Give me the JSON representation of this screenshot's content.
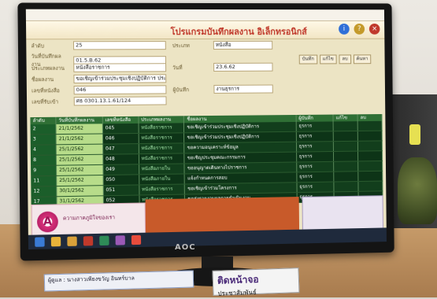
{
  "app": {
    "title": "โปรแกรมบันทึกผลงาน อิเล็กทรอนิกส์",
    "form": {
      "field1_label": "ลำดับ",
      "field1_value": "25",
      "field2_label": "วันที่บันทึกผลงาน",
      "field2_value": "01.5.B.62",
      "field3_label": "ประเภทผลงาน",
      "field3_value": "หนังสือราชการ",
      "field4_label": "ชื่อผลงาน",
      "field4_value": "ขอเชิญเข้าร่วมประชุมเชิงปฏิบัติการ ประจำปีการศึกษา",
      "field5_label": "เลขที่หนังสือ",
      "field5_value": "046",
      "field6_label": "เลขที่รับเข้า",
      "field6_value": "ศธ 0301.13.1.61/124",
      "right_label1": "ประเภท",
      "right_value1": "หนังสือ",
      "right_label2": "วันที่",
      "right_value2": "23.6.62",
      "right_label3": "ผู้บันทึก",
      "right_value3": "งานธุรการ",
      "button_labels": [
        "บันทึก",
        "แก้ไข",
        "ลบ",
        "ค้นหา"
      ]
    },
    "grid": {
      "headers": [
        "ลำดับ",
        "วันที่บันทึกผลงาน",
        "เลขที่หนังสือ",
        "ประเภทผลงาน",
        "ชื่อผลงาน",
        "ผู้บันทึก",
        "แก้ไข",
        "ลบ"
      ],
      "rows": [
        [
          "2",
          "21/1/2562",
          "045",
          "หนังสือราชการ",
          "ขอเชิญเข้าร่วมประชุมเชิงปฏิบัติการ",
          "ธุรการ",
          "",
          ""
        ],
        [
          "3",
          "21/1/2562",
          "046",
          "หนังสือราชการ",
          "ขอเชิญเข้าร่วมประชุมเชิงปฏิบัติการ",
          "ธุรการ",
          "",
          ""
        ],
        [
          "4",
          "25/1/2562",
          "047",
          "หนังสือราชการ",
          "ขอความอนุเคราะห์ข้อมูล",
          "ธุรการ",
          "",
          ""
        ],
        [
          "8",
          "25/1/2562",
          "048",
          "หนังสือราชการ",
          "ขอเชิญประชุมคณะกรรมการ",
          "ธุรการ",
          "",
          ""
        ],
        [
          "9",
          "25/1/2562",
          "049",
          "หนังสือภายใน",
          "ขออนุญาตเดินทางไปราชการ",
          "ธุรการ",
          "",
          ""
        ],
        [
          "11",
          "25/1/2562",
          "050",
          "หนังสือภายใน",
          "แจ้งกำหนดการสอบ",
          "ธุรการ",
          "",
          ""
        ],
        [
          "12",
          "30/1/2562",
          "051",
          "หนังสือราชการ",
          "ขอเชิญเข้าร่วมโครงการ",
          "ธุรการ",
          "",
          ""
        ],
        [
          "17",
          "31/1/2562",
          "052",
          "หนังสือราชการ",
          "ขอส่งรายงานผลการดำเนินงาน",
          "ธุรการ",
          "",
          ""
        ]
      ]
    },
    "logo_text": "ความภาคภูมิใจของเรา",
    "logo_letter": "A"
  },
  "monitor_brand": "AOC",
  "sticker_text": "ผู้ดูแล : นางสาวเพียงขวัญ อินทร์บาล",
  "card_big": "ติดหน้าจอ",
  "card_small": "ประชาสัมพันธ์"
}
